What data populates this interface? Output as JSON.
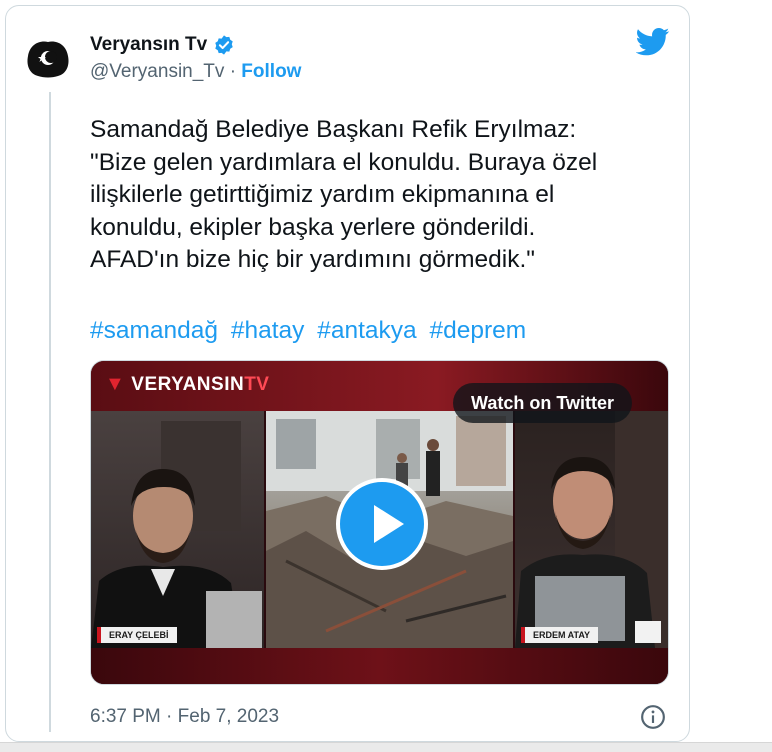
{
  "tweet": {
    "display_name": "Veryansın Tv",
    "handle": "@Veryansin_Tv",
    "separator": "·",
    "follow_label": "Follow",
    "text": "Samandağ Belediye Başkanı Refik Eryılmaz:\n\"Bize gelen yardımlara el konuldu. Buraya özel\nilişkilerle getirttiğimiz yardım ekipmanına el\nkonuldu, ekipler başka yerlere gönderildi.\nAFAD'ın bize hiç bir yardımını görmedik.\"",
    "hashtags": [
      "#samandağ",
      "#hatay",
      "#antakya",
      "#deprem"
    ],
    "timestamp": "6:37 PM · Feb 7, 2023"
  },
  "media": {
    "logo_text": "VERYANSIN",
    "logo_suffix": "TV",
    "watch_label": "Watch on Twitter",
    "nametag_left": "ERAY ÇELEBİ",
    "nametag_right": "ERDEM ATAY"
  },
  "icons": {
    "verified": "verified-badge-icon",
    "brand": "twitter-bird-icon",
    "play": "play-icon",
    "info": "info-icon"
  },
  "colors": {
    "accent": "#1d9bf0",
    "text": "#0f1419",
    "secondary": "#536471",
    "border": "#cfd9de"
  }
}
